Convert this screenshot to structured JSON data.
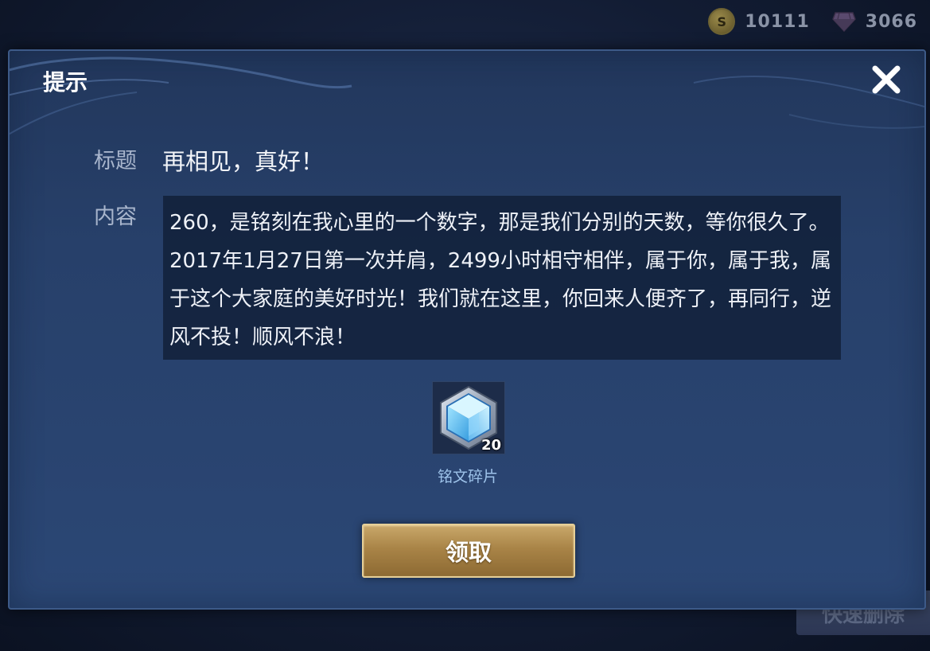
{
  "top_bar": {
    "coin_icon": "gold-coin-icon",
    "coin_symbol": "S",
    "coin_value": "10111",
    "gem_icon": "diamond-gem-icon",
    "gem_value": "3066"
  },
  "background": {
    "quick_delete_label": "快速删除"
  },
  "dialog": {
    "title": "提示",
    "close_icon": "close-x-icon",
    "title_label": "标题",
    "title_value": "再相见，真好！",
    "content_label": "内容",
    "content_text": "260，是铭刻在我心里的一个数字，那是我们分别的天数，等你很久了。2017年1月27日第一次并肩，2499小时相守相伴，属于你，属于我，属于这个大家庭的美好时光！我们就在这里，你回来人便齐了，再同行，逆风不投！顺风不浪！",
    "reward": {
      "icon": "inscription-fragment-crystal-icon",
      "count": "20",
      "name": "铭文碎片"
    },
    "claim_button_label": "领取"
  },
  "colors": {
    "dialog_bg": "#27406a",
    "content_bg": "#0e1a30",
    "button_gold": "#a98447",
    "reward_name": "#9ec3ea"
  }
}
